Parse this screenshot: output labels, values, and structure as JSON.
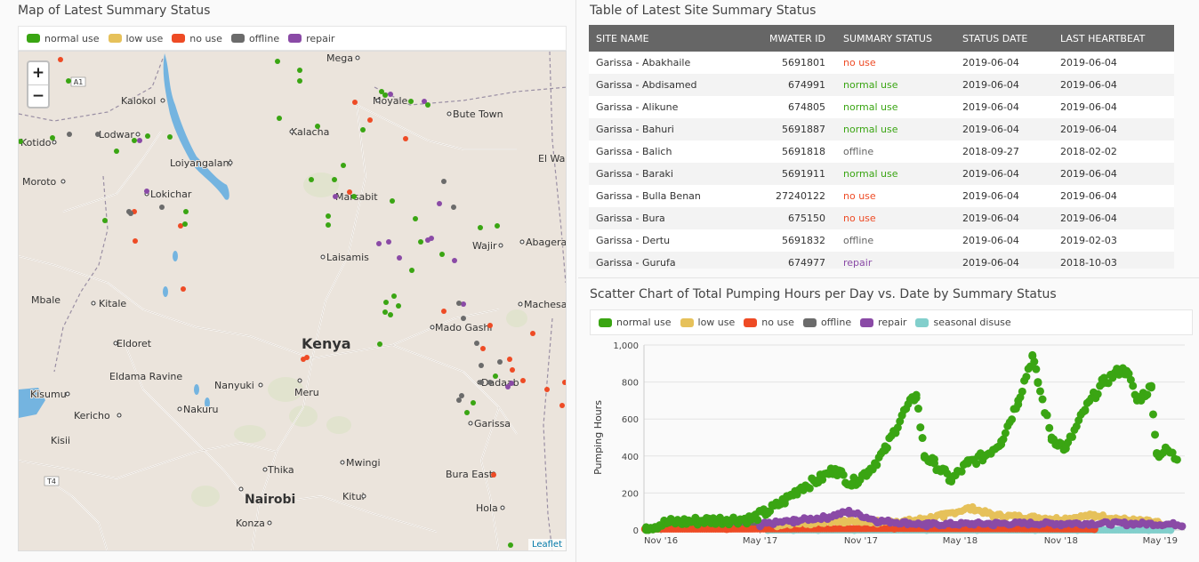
{
  "map": {
    "title": "Map of Latest Summary Status",
    "legend": [
      {
        "label": "normal use",
        "color": "#3aa513"
      },
      {
        "label": "low use",
        "color": "#e6c15a"
      },
      {
        "label": "no use",
        "color": "#ee4b25"
      },
      {
        "label": "offline",
        "color": "#6b6b6b"
      },
      {
        "label": "repair",
        "color": "#8a4aa6"
      }
    ],
    "zoom_in": "+",
    "zoom_out": "−",
    "attribution": "Leaflet",
    "country": "Kenya",
    "places": [
      "Mega",
      "Moyale",
      "Bute Town",
      "Kalokol",
      "Lodwar",
      "Kotido",
      "Kalacha",
      "Loiyangalani",
      "El Wak",
      "Moroto",
      "Lokichar",
      "Marsabit",
      "Wajir",
      "Abagera",
      "Laisamis",
      "Mbale",
      "Kitale",
      "Machesa",
      "Mado Gashi",
      "Eldoret",
      "Eldama Ravine",
      "Nanyuki",
      "Meru",
      "Dadaab",
      "Kisumu",
      "Kericho",
      "Nakuru",
      "Garissa",
      "Kisii",
      "Thika",
      "Mwingi",
      "Bura East",
      "Nairobi",
      "Kitui",
      "Konza",
      "Hola"
    ],
    "roads": [
      "A1",
      "T4"
    ]
  },
  "table": {
    "title": "Table of Latest Site Summary Status",
    "columns": [
      "SITE NAME",
      "MWATER ID",
      "SUMMARY STATUS",
      "STATUS DATE",
      "LAST HEARTBEAT"
    ],
    "rows": [
      [
        "Garissa - Abakhaile",
        "5691801",
        "no use",
        "2019-06-04",
        "2019-06-04"
      ],
      [
        "Garissa - Abdisamed",
        "674991",
        "normal use",
        "2019-06-04",
        "2019-06-04"
      ],
      [
        "Garissa - Alikune",
        "674805",
        "normal use",
        "2019-06-04",
        "2019-06-04"
      ],
      [
        "Garissa - Bahuri",
        "5691887",
        "normal use",
        "2019-06-04",
        "2019-06-04"
      ],
      [
        "Garissa - Balich",
        "5691818",
        "offline",
        "2018-09-27",
        "2018-02-02"
      ],
      [
        "Garissa - Baraki",
        "5691911",
        "normal use",
        "2019-06-04",
        "2019-06-04"
      ],
      [
        "Garissa - Bulla Benan",
        "27240122",
        "no use",
        "2019-06-04",
        "2019-06-04"
      ],
      [
        "Garissa - Bura",
        "675150",
        "no use",
        "2019-06-04",
        "2019-06-04"
      ],
      [
        "Garissa - Dertu",
        "5691832",
        "offline",
        "2019-06-04",
        "2019-02-03"
      ],
      [
        "Garissa - Gurufa",
        "674977",
        "repair",
        "2019-06-04",
        "2018-10-03"
      ]
    ],
    "status_colors": {
      "no use": "#ee4b25",
      "normal use": "#3aa513",
      "offline": "#666666",
      "repair": "#8a4aa6",
      "low use": "#d4a23a"
    }
  },
  "scatter": {
    "title": "Scatter Chart of Total Pumping Hours per Day vs. Date by Summary Status",
    "legend": [
      {
        "label": "normal use",
        "color": "#3aa513"
      },
      {
        "label": "low use",
        "color": "#e6c15a"
      },
      {
        "label": "no use",
        "color": "#ee4b25"
      },
      {
        "label": "offline",
        "color": "#6b6b6b"
      },
      {
        "label": "repair",
        "color": "#8a4aa6"
      },
      {
        "label": "seasonal disuse",
        "color": "#82cfcc"
      }
    ]
  },
  "chart_data": {
    "type": "scatter",
    "title": "Scatter Chart of Total Pumping Hours per Day vs. Date by Summary Status",
    "xlabel": "",
    "ylabel": "Pumping Hours",
    "ylim": [
      0,
      1000
    ],
    "y_ticks": [
      "0",
      "200",
      "400",
      "600",
      "800",
      "1,000"
    ],
    "x_range": [
      "2016-10-01",
      "2019-06-15"
    ],
    "x_ticks": [
      {
        "date": "2016-11-01",
        "label": "Nov '16"
      },
      {
        "date": "2017-05-01",
        "label": "May '17"
      },
      {
        "date": "2017-11-01",
        "label": "Nov '17"
      },
      {
        "date": "2018-05-01",
        "label": "May '18"
      },
      {
        "date": "2018-11-01",
        "label": "Nov '18"
      },
      {
        "date": "2019-05-01",
        "label": "May '19"
      }
    ],
    "grid": true,
    "legend_position": "top",
    "series": [
      {
        "name": "normal use",
        "color": "#3aa513",
        "points": [
          [
            "2016-10-05",
            15
          ],
          [
            "2016-11-15",
            40
          ],
          [
            "2017-01-15",
            50
          ],
          [
            "2017-03-01",
            55
          ],
          [
            "2017-04-15",
            60
          ],
          [
            "2017-05-15",
            100
          ],
          [
            "2017-06-15",
            160
          ],
          [
            "2017-07-15",
            230
          ],
          [
            "2017-08-15",
            270
          ],
          [
            "2017-09-15",
            330
          ],
          [
            "2017-10-15",
            250
          ],
          [
            "2017-11-15",
            320
          ],
          [
            "2017-12-15",
            430
          ],
          [
            "2018-01-15",
            620
          ],
          [
            "2018-02-10",
            730
          ],
          [
            "2018-02-25",
            400
          ],
          [
            "2018-03-15",
            360
          ],
          [
            "2018-04-15",
            270
          ],
          [
            "2018-05-15",
            360
          ],
          [
            "2018-06-15",
            400
          ],
          [
            "2018-07-15",
            480
          ],
          [
            "2018-08-15",
            700
          ],
          [
            "2018-09-10",
            940
          ],
          [
            "2018-09-20",
            800
          ],
          [
            "2018-10-15",
            500
          ],
          [
            "2018-11-10",
            440
          ],
          [
            "2018-12-15",
            650
          ],
          [
            "2019-01-15",
            790
          ],
          [
            "2019-02-15",
            860
          ],
          [
            "2019-03-01",
            860
          ],
          [
            "2019-03-20",
            700
          ],
          [
            "2019-04-15",
            770
          ],
          [
            "2019-04-25",
            410
          ],
          [
            "2019-05-15",
            430
          ],
          [
            "2019-06-01",
            380
          ]
        ]
      },
      {
        "name": "low use",
        "color": "#e6c15a",
        "points": [
          [
            "2017-06-01",
            20
          ],
          [
            "2017-08-01",
            30
          ],
          [
            "2017-10-01",
            40
          ],
          [
            "2017-12-01",
            35
          ],
          [
            "2018-02-01",
            40
          ],
          [
            "2018-04-01",
            70
          ],
          [
            "2018-05-20",
            110
          ],
          [
            "2018-07-01",
            70
          ],
          [
            "2018-09-01",
            60
          ],
          [
            "2018-11-01",
            50
          ],
          [
            "2019-01-01",
            70
          ],
          [
            "2019-03-01",
            45
          ],
          [
            "2019-05-01",
            30
          ]
        ]
      },
      {
        "name": "no use",
        "color": "#ee4b25",
        "points": [
          [
            "2016-10-03",
            5
          ],
          [
            "2017-03-01",
            5
          ],
          [
            "2018-01-01",
            8
          ],
          [
            "2019-01-01",
            5
          ]
        ]
      },
      {
        "name": "offline",
        "color": "#6b6b6b",
        "points": [
          [
            "2016-10-05",
            5
          ],
          [
            "2016-12-01",
            15
          ],
          [
            "2017-02-01",
            15
          ],
          [
            "2017-04-01",
            20
          ],
          [
            "2017-06-01",
            25
          ]
        ]
      },
      {
        "name": "repair",
        "color": "#8a4aa6",
        "points": [
          [
            "2017-05-01",
            20
          ],
          [
            "2017-07-01",
            40
          ],
          [
            "2017-09-01",
            60
          ],
          [
            "2017-10-10",
            90
          ],
          [
            "2017-12-01",
            40
          ],
          [
            "2018-03-01",
            20
          ],
          [
            "2018-07-01",
            25
          ],
          [
            "2018-11-01",
            25
          ],
          [
            "2019-03-01",
            25
          ],
          [
            "2019-06-10",
            20
          ]
        ]
      },
      {
        "name": "seasonal disuse",
        "color": "#82cfcc",
        "points": [
          [
            "2017-05-15",
            0
          ],
          [
            "2017-07-01",
            0
          ],
          [
            "2017-08-15",
            0
          ],
          [
            "2017-10-20",
            0
          ],
          [
            "2018-03-01",
            0
          ],
          [
            "2018-06-01",
            0
          ],
          [
            "2018-09-15",
            0
          ],
          [
            "2018-12-01",
            0
          ],
          [
            "2019-04-10",
            0
          ],
          [
            "2019-05-20",
            0
          ]
        ]
      }
    ]
  }
}
